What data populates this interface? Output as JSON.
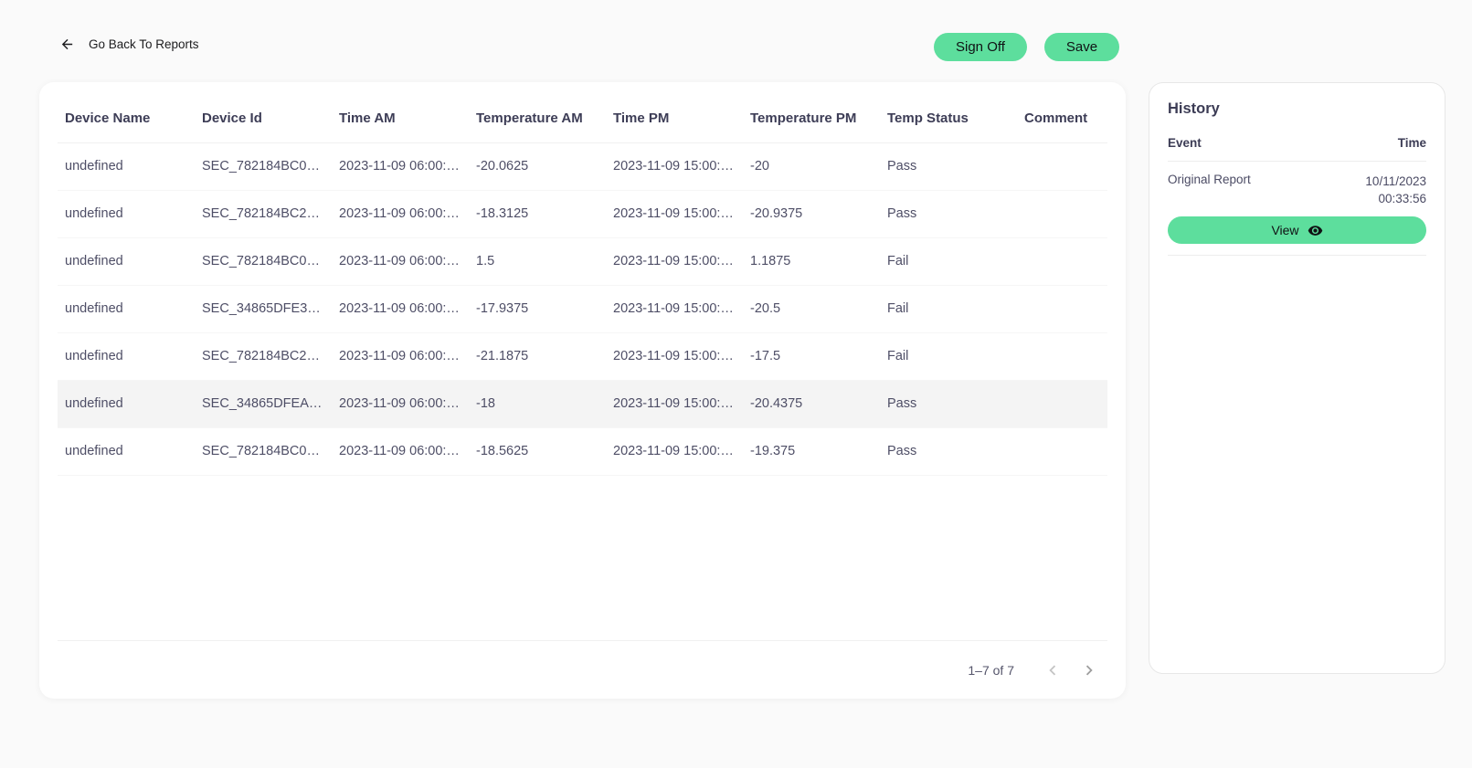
{
  "colors": {
    "accent_green": "#5dde9d",
    "page_background": "#fafafa",
    "header_text": "#3d3d56",
    "body_text": "#4e4e66",
    "highlight_row": "#f4f4f4"
  },
  "topbar": {
    "back_label": "Go Back To Reports",
    "sign_off_label": "Sign Off",
    "save_label": "Save"
  },
  "table": {
    "columns": [
      "Device Name",
      "Device Id",
      "Time AM",
      "Temperature AM",
      "Time PM",
      "Temperature PM",
      "Temp Status",
      "Comment"
    ],
    "rows": [
      {
        "device_name": "undefined",
        "device_id": "SEC_782184BC0…",
        "time_am": "2023-11-09 06:00:…",
        "temp_am": "-20.0625",
        "time_pm": "2023-11-09 15:00:…",
        "temp_pm": "-20",
        "status": "Pass",
        "comment": "",
        "highlighted": false
      },
      {
        "device_name": "undefined",
        "device_id": "SEC_782184BC2…",
        "time_am": "2023-11-09 06:00:…",
        "temp_am": "-18.3125",
        "time_pm": "2023-11-09 15:00:…",
        "temp_pm": "-20.9375",
        "status": "Pass",
        "comment": "",
        "highlighted": false
      },
      {
        "device_name": "undefined",
        "device_id": "SEC_782184BC0…",
        "time_am": "2023-11-09 06:00:…",
        "temp_am": "1.5",
        "time_pm": "2023-11-09 15:00:…",
        "temp_pm": "1.1875",
        "status": "Fail",
        "comment": "",
        "highlighted": false
      },
      {
        "device_name": "undefined",
        "device_id": "SEC_34865DFE3…",
        "time_am": "2023-11-09 06:00:…",
        "temp_am": "-17.9375",
        "time_pm": "2023-11-09 15:00:…",
        "temp_pm": "-20.5",
        "status": "Fail",
        "comment": "",
        "highlighted": false
      },
      {
        "device_name": "undefined",
        "device_id": "SEC_782184BC2…",
        "time_am": "2023-11-09 06:00:…",
        "temp_am": "-21.1875",
        "time_pm": "2023-11-09 15:00:…",
        "temp_pm": "-17.5",
        "status": "Fail",
        "comment": "",
        "highlighted": false
      },
      {
        "device_name": "undefined",
        "device_id": "SEC_34865DFEA…",
        "time_am": "2023-11-09 06:00:…",
        "temp_am": "-18",
        "time_pm": "2023-11-09 15:00:…",
        "temp_pm": "-20.4375",
        "status": "Pass",
        "comment": "",
        "highlighted": true
      },
      {
        "device_name": "undefined",
        "device_id": "SEC_782184BC0…",
        "time_am": "2023-11-09 06:00:…",
        "temp_am": "-18.5625",
        "time_pm": "2023-11-09 15:00:…",
        "temp_pm": "-19.375",
        "status": "Pass",
        "comment": "",
        "highlighted": false
      }
    ],
    "pagination": {
      "range_label": "1–7 of 7"
    }
  },
  "history": {
    "title": "History",
    "event_header": "Event",
    "time_header": "Time",
    "entries": [
      {
        "event": "Original Report",
        "date": "10/11/2023",
        "time": "00:33:56",
        "action_label": "View"
      }
    ]
  }
}
